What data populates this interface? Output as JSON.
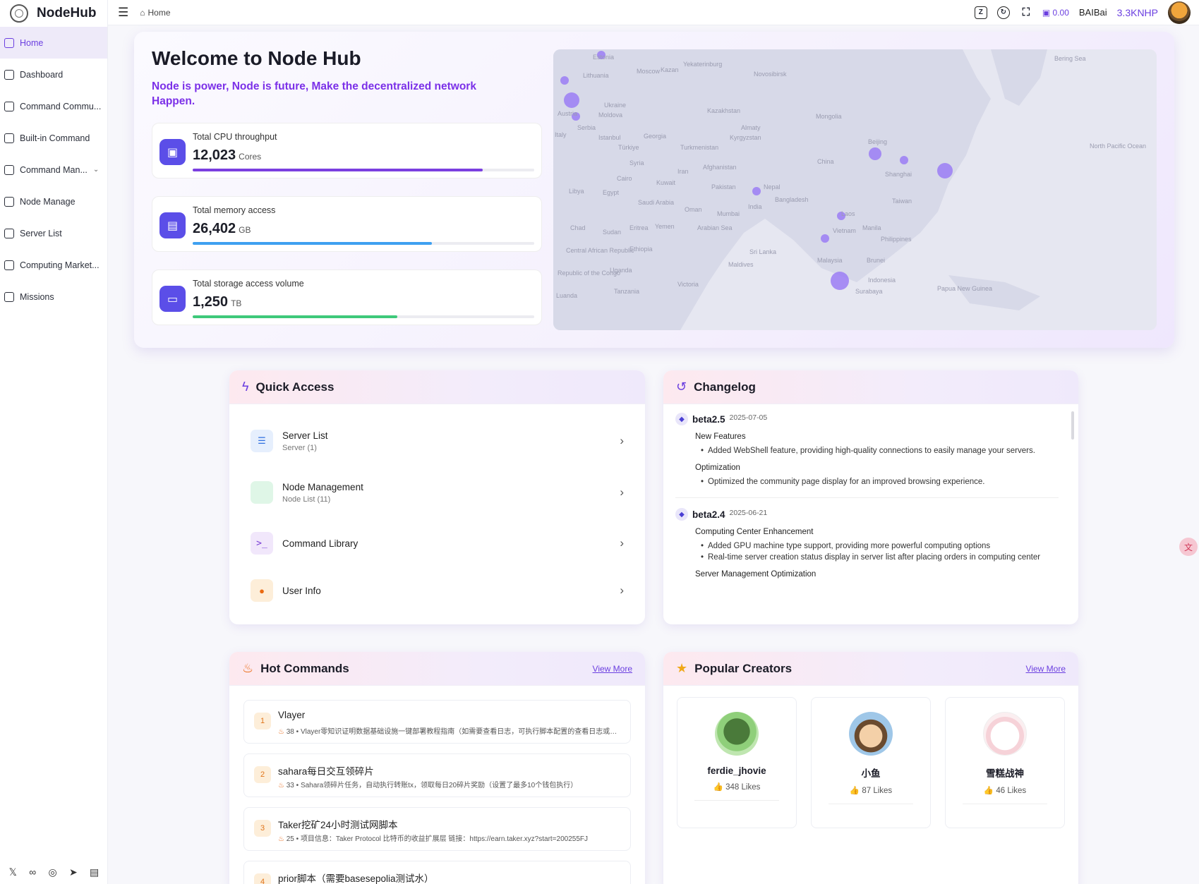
{
  "app": {
    "name": "NodeHub"
  },
  "sidebar": {
    "items": [
      {
        "label": "Home",
        "icon": "home-icon",
        "active": true
      },
      {
        "label": "Dashboard",
        "icon": "dashboard-icon"
      },
      {
        "label": "Command Commu...",
        "icon": "community-icon"
      },
      {
        "label": "Built-in Command",
        "icon": "command-icon"
      },
      {
        "label": "Command Man...",
        "icon": "terminal-icon",
        "expandable": true
      },
      {
        "label": "Node Manage",
        "icon": "node-icon"
      },
      {
        "label": "Server List",
        "icon": "server-icon"
      },
      {
        "label": "Computing Market...",
        "icon": "market-icon"
      },
      {
        "label": "Missions",
        "icon": "calendar-icon"
      }
    ],
    "footer_icons": [
      "x-icon",
      "discord-icon",
      "game-icon",
      "telegram-icon",
      "docs-icon"
    ]
  },
  "header": {
    "breadcrumb": "Home",
    "balance": "0.00",
    "username": "BAIBai",
    "points": "3.3KNHP"
  },
  "hero": {
    "title": "Welcome to Node Hub",
    "subtitle": "Node is power, Node is future, Make the decentralized network Happen.",
    "stats": [
      {
        "label": "Total CPU throughput",
        "value": "12,023",
        "unit": "Cores",
        "progress": 0.85,
        "color": "#7b3fe0"
      },
      {
        "label": "Total memory access",
        "value": "26,402",
        "unit": "GB",
        "progress": 0.7,
        "color": "#3ea0f0"
      },
      {
        "label": "Total storage access volume",
        "value": "1,250",
        "unit": "TB",
        "progress": 0.6,
        "color": "#3ec97a"
      }
    ],
    "map_labels": [
      "Moscow",
      "Kazan",
      "Yekaterinburg",
      "Novosibirsk",
      "Ukraine",
      "Kazakhstan",
      "Mongolia",
      "Istanbul",
      "Türkiye",
      "Turkmenistan",
      "Kyrgyzstan",
      "Afghanistan",
      "Iran",
      "Syria",
      "Cairo",
      "Egypt",
      "Libya",
      "Saudi Arabia",
      "Pakistan",
      "Nepal",
      "India",
      "Bangladesh",
      "Oman",
      "Mumbai",
      "China",
      "Beijing",
      "Shanghai",
      "Laos",
      "Vietnam",
      "Manila",
      "Philippines",
      "Chad",
      "Sudan",
      "Eritrea",
      "Yemen",
      "Arabian Sea",
      "Ethiopia",
      "Sri Lanka",
      "Maldives",
      "Malaysia",
      "Indonesia",
      "Surabaya",
      "Papua New Guinea",
      "Uganda",
      "Tanzania",
      "Victoria",
      "Bering Sea",
      "North Pacific Ocean",
      "Lithuania",
      "Moldova",
      "Serbia",
      "Georgia",
      "Almaty",
      "Kuwait",
      "Brunei",
      "Taiwan",
      "Central African Republic",
      "Republic of the Congo",
      "Luanda",
      "Italy",
      "Austria",
      "Estonia"
    ]
  },
  "quick_access": {
    "title": "Quick Access",
    "items": [
      {
        "name": "Server List",
        "sub": "Server (1)"
      },
      {
        "name": "Node Management",
        "sub": "Node List (11)"
      },
      {
        "name": "Command Library",
        "sub": ""
      },
      {
        "name": "User Info",
        "sub": ""
      }
    ]
  },
  "changelog": {
    "title": "Changelog",
    "entries": [
      {
        "version": "beta2.5",
        "date": "2025-07-05",
        "sections": [
          {
            "title": "New Features",
            "items": [
              "Added WebShell feature, providing high-quality connections to easily manage your servers."
            ]
          },
          {
            "title": "Optimization",
            "items": [
              "Optimized the community page display for an improved browsing experience."
            ]
          }
        ]
      },
      {
        "version": "beta2.4",
        "date": "2025-06-21",
        "sections": [
          {
            "title": "Computing Center Enhancement",
            "items": [
              "Added GPU machine type support, providing more powerful computing options",
              "Real-time server creation status display in server list after placing orders in computing center"
            ]
          },
          {
            "title": "Server Management Optimization",
            "items": []
          }
        ]
      }
    ]
  },
  "hot_commands": {
    "title": "Hot Commands",
    "view_more": "View More",
    "items": [
      {
        "rank": "1",
        "title": "Vlayer",
        "count": "38",
        "desc": "Vlayer零知识证明数据基础设施一键部署教程指南（如需要查看日志，可执行脚本配置的查看日志或者..."
      },
      {
        "rank": "2",
        "title": "sahara每日交互领碎片",
        "count": "33",
        "desc": "Sahara领碎片任务，自动执行转账tx，领取每日20碎片奖励（设置了最多10个钱包执行）"
      },
      {
        "rank": "3",
        "title": "Taker挖矿24小时测试网脚本",
        "count": "25",
        "desc": "项目信息：Taker Protocol 比特币的收益扩展层 链接：https://earn.taker.xyz?start=200255FJ"
      },
      {
        "rank": "4",
        "title": "prior脚本（需要basesepolia测试水）",
        "count": "",
        "desc": ""
      }
    ]
  },
  "creators": {
    "title": "Popular Creators",
    "view_more": "View More",
    "items": [
      {
        "name": "ferdie_jhovie",
        "likes": "348 Likes"
      },
      {
        "name": "小鱼",
        "likes": "87 Likes"
      },
      {
        "name": "雪糕战神",
        "likes": "46 Likes"
      }
    ]
  }
}
